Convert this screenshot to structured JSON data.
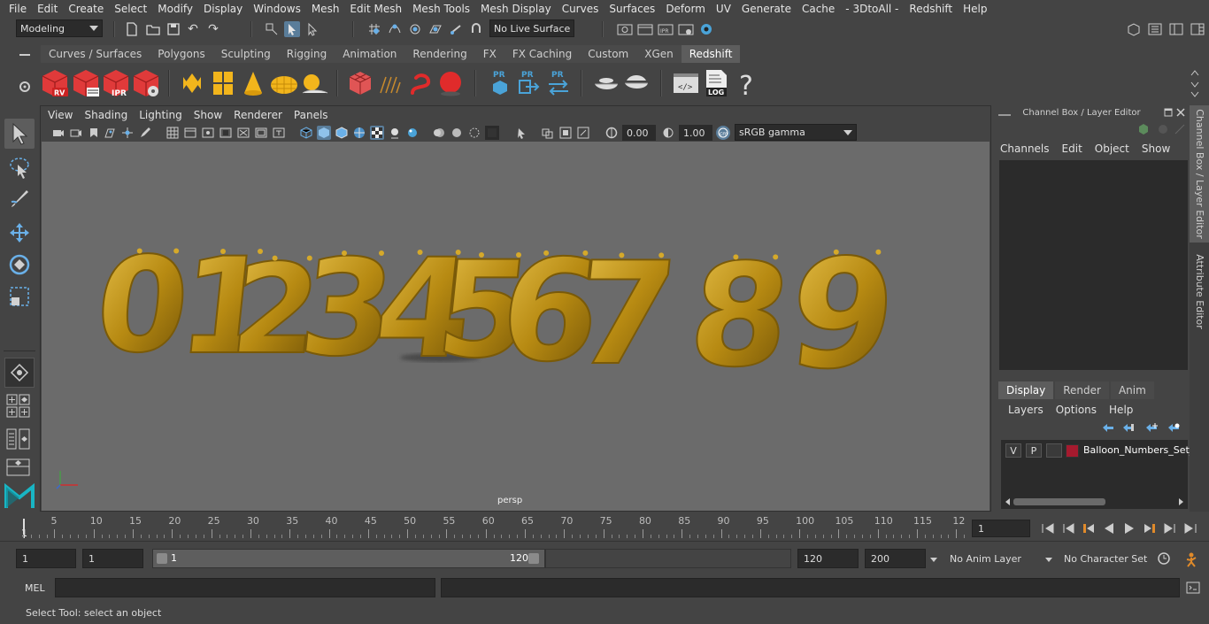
{
  "menubar": [
    "File",
    "Edit",
    "Create",
    "Select",
    "Modify",
    "Display",
    "Windows",
    "Mesh",
    "Edit Mesh",
    "Mesh Tools",
    "Mesh Display",
    "Curves",
    "Surfaces",
    "Deform",
    "UV",
    "Generate",
    "Cache",
    "- 3DtoAll -",
    "Redshift",
    "Help"
  ],
  "statusline": {
    "workspace": "Modeling",
    "live_surface": "No Live Surface"
  },
  "shelf_tabs": [
    "Curves / Surfaces",
    "Polygons",
    "Sculpting",
    "Rigging",
    "Animation",
    "Rendering",
    "FX",
    "FX Caching",
    "Custom",
    "XGen",
    "Redshift"
  ],
  "shelf_active_tab": "Redshift",
  "shelf_icons": {
    "rv": "RV",
    "ipr": "IPR",
    "pr": "PR",
    "log": "LOG",
    "help": "?"
  },
  "viewport": {
    "menu": [
      "View",
      "Shading",
      "Lighting",
      "Show",
      "Renderer",
      "Panels"
    ],
    "exposure": "0.00",
    "gamma": "1.00",
    "color_space": "sRGB gamma",
    "camera_label": "persp",
    "digits": [
      "0",
      "1",
      "2",
      "3",
      "4",
      "5",
      "6",
      "7",
      "8",
      "9"
    ],
    "balloon_color": "#b78a12"
  },
  "channel_box": {
    "title": "Channel Box / Layer Editor",
    "menu": [
      "Channels",
      "Edit",
      "Object",
      "Show"
    ]
  },
  "layer_editor": {
    "tabs": [
      "Display",
      "Render",
      "Anim"
    ],
    "active_tab": "Display",
    "menu": [
      "Layers",
      "Options",
      "Help"
    ],
    "layer": {
      "visibility": "V",
      "playback": "P",
      "name": "Balloon_Numbers_Set_",
      "color": "#a51a2e"
    }
  },
  "side_tabs": [
    "Channel Box / Layer Editor",
    "Attribute Editor"
  ],
  "timeslider": {
    "start_label": "1",
    "tick_labels": [
      "5",
      "10",
      "15",
      "20",
      "25",
      "30",
      "35",
      "40",
      "45",
      "50",
      "55",
      "60",
      "65",
      "70",
      "75",
      "80",
      "85",
      "90",
      "95",
      "100",
      "105",
      "110",
      "115",
      "12"
    ],
    "current_frame": "1"
  },
  "range": {
    "start": "1",
    "playback_start": "1",
    "slider_start": "1",
    "slider_end": "120",
    "playback_end": "120",
    "end": "200",
    "anim_layer": "No Anim Layer",
    "character_set": "No Character Set"
  },
  "command": {
    "language": "MEL"
  },
  "help_line": "Select Tool: select an object"
}
